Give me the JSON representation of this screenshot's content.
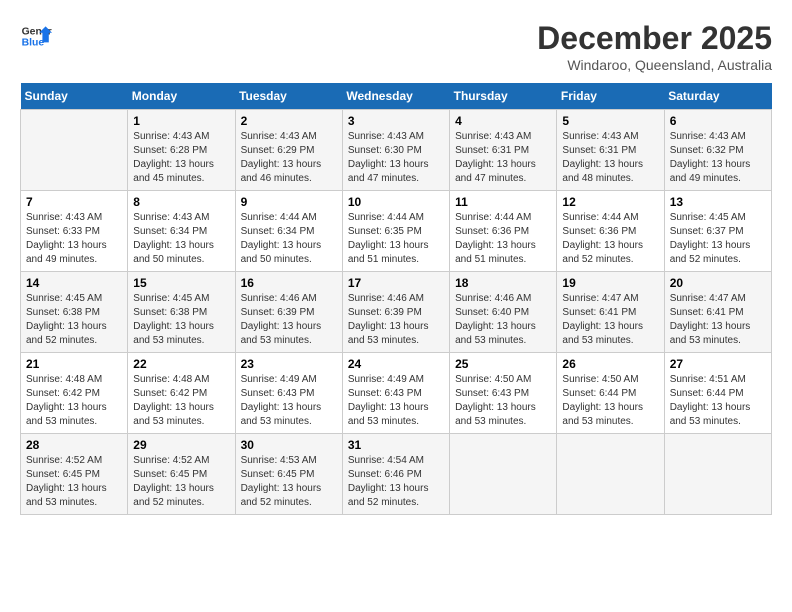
{
  "logo": {
    "line1": "General",
    "line2": "Blue"
  },
  "title": "December 2025",
  "subtitle": "Windaroo, Queensland, Australia",
  "headers": [
    "Sunday",
    "Monday",
    "Tuesday",
    "Wednesday",
    "Thursday",
    "Friday",
    "Saturday"
  ],
  "weeks": [
    [
      {
        "num": "",
        "detail": ""
      },
      {
        "num": "1",
        "detail": "Sunrise: 4:43 AM\nSunset: 6:28 PM\nDaylight: 13 hours\nand 45 minutes."
      },
      {
        "num": "2",
        "detail": "Sunrise: 4:43 AM\nSunset: 6:29 PM\nDaylight: 13 hours\nand 46 minutes."
      },
      {
        "num": "3",
        "detail": "Sunrise: 4:43 AM\nSunset: 6:30 PM\nDaylight: 13 hours\nand 47 minutes."
      },
      {
        "num": "4",
        "detail": "Sunrise: 4:43 AM\nSunset: 6:31 PM\nDaylight: 13 hours\nand 47 minutes."
      },
      {
        "num": "5",
        "detail": "Sunrise: 4:43 AM\nSunset: 6:31 PM\nDaylight: 13 hours\nand 48 minutes."
      },
      {
        "num": "6",
        "detail": "Sunrise: 4:43 AM\nSunset: 6:32 PM\nDaylight: 13 hours\nand 49 minutes."
      }
    ],
    [
      {
        "num": "7",
        "detail": "Sunrise: 4:43 AM\nSunset: 6:33 PM\nDaylight: 13 hours\nand 49 minutes."
      },
      {
        "num": "8",
        "detail": "Sunrise: 4:43 AM\nSunset: 6:34 PM\nDaylight: 13 hours\nand 50 minutes."
      },
      {
        "num": "9",
        "detail": "Sunrise: 4:44 AM\nSunset: 6:34 PM\nDaylight: 13 hours\nand 50 minutes."
      },
      {
        "num": "10",
        "detail": "Sunrise: 4:44 AM\nSunset: 6:35 PM\nDaylight: 13 hours\nand 51 minutes."
      },
      {
        "num": "11",
        "detail": "Sunrise: 4:44 AM\nSunset: 6:36 PM\nDaylight: 13 hours\nand 51 minutes."
      },
      {
        "num": "12",
        "detail": "Sunrise: 4:44 AM\nSunset: 6:36 PM\nDaylight: 13 hours\nand 52 minutes."
      },
      {
        "num": "13",
        "detail": "Sunrise: 4:45 AM\nSunset: 6:37 PM\nDaylight: 13 hours\nand 52 minutes."
      }
    ],
    [
      {
        "num": "14",
        "detail": "Sunrise: 4:45 AM\nSunset: 6:38 PM\nDaylight: 13 hours\nand 52 minutes."
      },
      {
        "num": "15",
        "detail": "Sunrise: 4:45 AM\nSunset: 6:38 PM\nDaylight: 13 hours\nand 53 minutes."
      },
      {
        "num": "16",
        "detail": "Sunrise: 4:46 AM\nSunset: 6:39 PM\nDaylight: 13 hours\nand 53 minutes."
      },
      {
        "num": "17",
        "detail": "Sunrise: 4:46 AM\nSunset: 6:39 PM\nDaylight: 13 hours\nand 53 minutes."
      },
      {
        "num": "18",
        "detail": "Sunrise: 4:46 AM\nSunset: 6:40 PM\nDaylight: 13 hours\nand 53 minutes."
      },
      {
        "num": "19",
        "detail": "Sunrise: 4:47 AM\nSunset: 6:41 PM\nDaylight: 13 hours\nand 53 minutes."
      },
      {
        "num": "20",
        "detail": "Sunrise: 4:47 AM\nSunset: 6:41 PM\nDaylight: 13 hours\nand 53 minutes."
      }
    ],
    [
      {
        "num": "21",
        "detail": "Sunrise: 4:48 AM\nSunset: 6:42 PM\nDaylight: 13 hours\nand 53 minutes."
      },
      {
        "num": "22",
        "detail": "Sunrise: 4:48 AM\nSunset: 6:42 PM\nDaylight: 13 hours\nand 53 minutes."
      },
      {
        "num": "23",
        "detail": "Sunrise: 4:49 AM\nSunset: 6:43 PM\nDaylight: 13 hours\nand 53 minutes."
      },
      {
        "num": "24",
        "detail": "Sunrise: 4:49 AM\nSunset: 6:43 PM\nDaylight: 13 hours\nand 53 minutes."
      },
      {
        "num": "25",
        "detail": "Sunrise: 4:50 AM\nSunset: 6:43 PM\nDaylight: 13 hours\nand 53 minutes."
      },
      {
        "num": "26",
        "detail": "Sunrise: 4:50 AM\nSunset: 6:44 PM\nDaylight: 13 hours\nand 53 minutes."
      },
      {
        "num": "27",
        "detail": "Sunrise: 4:51 AM\nSunset: 6:44 PM\nDaylight: 13 hours\nand 53 minutes."
      }
    ],
    [
      {
        "num": "28",
        "detail": "Sunrise: 4:52 AM\nSunset: 6:45 PM\nDaylight: 13 hours\nand 53 minutes."
      },
      {
        "num": "29",
        "detail": "Sunrise: 4:52 AM\nSunset: 6:45 PM\nDaylight: 13 hours\nand 52 minutes."
      },
      {
        "num": "30",
        "detail": "Sunrise: 4:53 AM\nSunset: 6:45 PM\nDaylight: 13 hours\nand 52 minutes."
      },
      {
        "num": "31",
        "detail": "Sunrise: 4:54 AM\nSunset: 6:46 PM\nDaylight: 13 hours\nand 52 minutes."
      },
      {
        "num": "",
        "detail": ""
      },
      {
        "num": "",
        "detail": ""
      },
      {
        "num": "",
        "detail": ""
      }
    ]
  ]
}
